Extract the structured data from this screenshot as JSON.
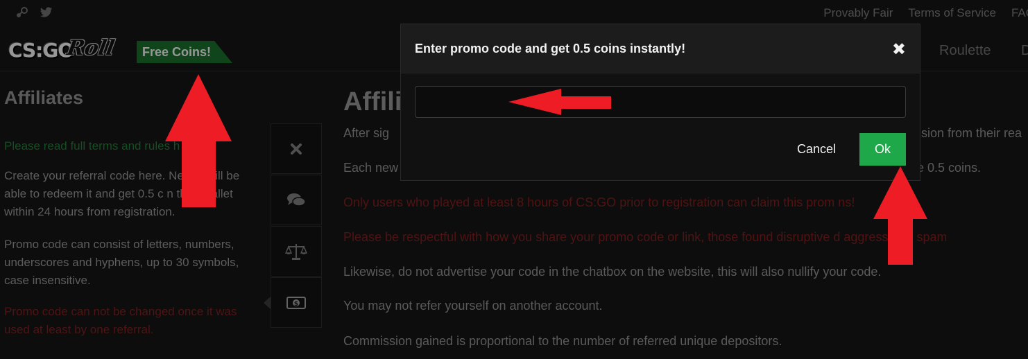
{
  "header": {
    "social": [
      "steam-icon",
      "twitter-icon"
    ],
    "top_links": [
      "Provably Fair",
      "Terms of Service",
      "FAQ"
    ],
    "logo": {
      "part1": "CS:GO",
      "part2": "Roll"
    },
    "free_coins": "Free Coins!",
    "nav": [
      {
        "label": "Roulette"
      },
      {
        "label": "D"
      }
    ]
  },
  "sidebar": {
    "title": "Affiliates",
    "read_terms": "Please read full terms and rules h",
    "p1": "Create your referral code here. Ne   ers will be able to redeem it and get 0.5 c     n their wallet within 24 hours from registration.",
    "p2": "Promo code can consist of letters, numbers, underscores and hyphens, up to 30 symbols, case insensitive.",
    "p3": "Promo code can not be changed once it was used at least by one referral."
  },
  "icons": [
    "close-icon",
    "chat-icon",
    "scales-icon",
    "money-icon"
  ],
  "main": {
    "title": "Affili",
    "p1_left": "After sig",
    "p1_right": "sion from their rea",
    "p2_left": "Each new",
    "p2_right": "e 0.5 coins.",
    "p3": "Only users who played at least 8 hours of CS:GO prior to registration can claim this prom      ns!",
    "p4": "Please be respectful with how you share your promo code or link, those found disruptive    d aggressively spam",
    "p5": "Likewise, do not advertise your code in the chatbox on the website, this will also nullify your code.",
    "p6": "You may not refer yourself on another account.",
    "p7": "Commission gained is proportional to the number of referred unique depositors."
  },
  "modal": {
    "title": "Enter promo code and get 0.5 coins instantly!",
    "close": "✖",
    "input_value": "",
    "cancel": "Cancel",
    "ok": "Ok"
  },
  "colors": {
    "accent_green": "#1fa84a",
    "free_coins_bg": "#1a6b2c",
    "annotation_red": "#ee1c24"
  }
}
